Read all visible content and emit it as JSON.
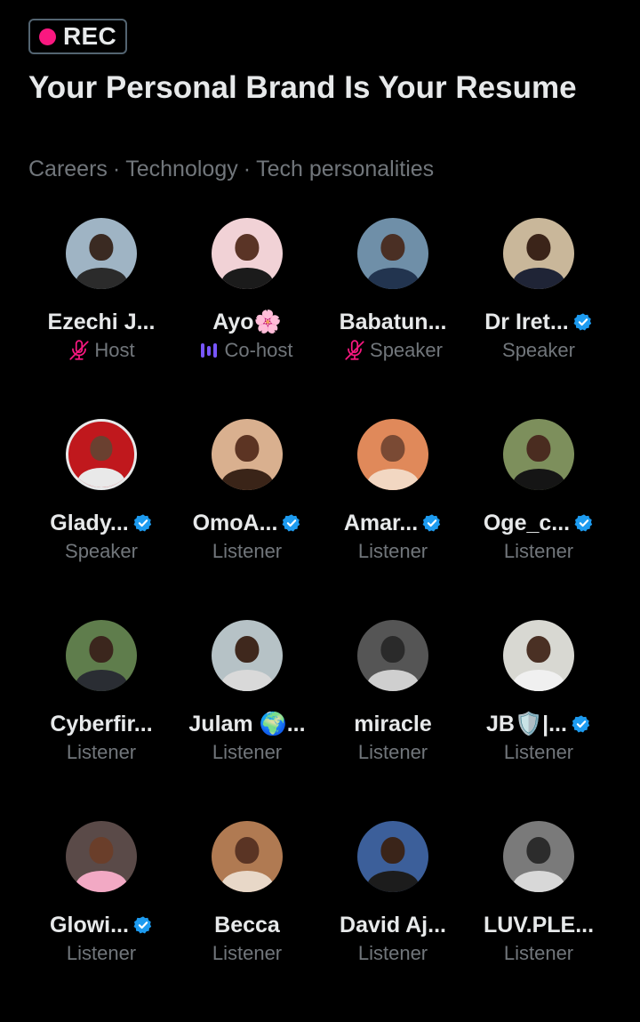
{
  "space": {
    "rec_label": "REC",
    "title": "Your Personal Brand Is Your Resume",
    "topics": [
      "Careers",
      "Technology",
      "Tech personalities"
    ],
    "topic_separator": "·"
  },
  "colors": {
    "rec_dot": "#f91880",
    "verified": "#1d9bf0",
    "muted_mic": "#f91880",
    "speaking": "#7856ff",
    "secondary_text": "#71767b"
  },
  "participants": [
    {
      "name": "Ezechi J...",
      "role": "Host",
      "verified": false,
      "mic": "muted",
      "avatar": {
        "bg": "#9fb4c4",
        "skin": "#3a2a22",
        "shirt": "#2b2b2b",
        "ring": false
      }
    },
    {
      "name": "Ayo🌸",
      "role": "Co-host",
      "verified": false,
      "mic": "speaking",
      "avatar": {
        "bg": "#f1d2d6",
        "skin": "#5a3426",
        "shirt": "#1b1b1b",
        "ring": false
      }
    },
    {
      "name": "Babatun...",
      "role": "Speaker",
      "verified": false,
      "mic": "muted",
      "avatar": {
        "bg": "#6f8fa8",
        "skin": "#4a2f24",
        "shirt": "#22344f",
        "ring": false
      }
    },
    {
      "name": "Dr Iret...",
      "role": "Speaker",
      "verified": true,
      "mic": "none",
      "avatar": {
        "bg": "#c9b79a",
        "skin": "#3b2419",
        "shirt": "#1f2436",
        "ring": false
      }
    },
    {
      "name": "Glady...",
      "role": "Speaker",
      "verified": true,
      "mic": "none",
      "avatar": {
        "bg": "#c0181d",
        "skin": "#6a4030",
        "shirt": "#e9e9e9",
        "ring": true
      }
    },
    {
      "name": "OmoA...",
      "role": "Listener",
      "verified": true,
      "mic": "none",
      "avatar": {
        "bg": "#d9b08f",
        "skin": "#5c3423",
        "shirt": "#3a2418",
        "ring": false
      }
    },
    {
      "name": "Amar...",
      "role": "Listener",
      "verified": true,
      "mic": "none",
      "avatar": {
        "bg": "#e0895a",
        "skin": "#7a4a34",
        "shirt": "#f2d7c2",
        "ring": false
      }
    },
    {
      "name": "Oge_c...",
      "role": "Listener",
      "verified": true,
      "mic": "none",
      "avatar": {
        "bg": "#7d8f5c",
        "skin": "#4a2c20",
        "shirt": "#151515",
        "ring": false
      }
    },
    {
      "name": "Cyberfir...",
      "role": "Listener",
      "verified": false,
      "mic": "none",
      "avatar": {
        "bg": "#5f7d4c",
        "skin": "#3b261d",
        "shirt": "#2a2d33",
        "ring": false
      }
    },
    {
      "name": "Julam 🌍...",
      "role": "Listener",
      "verified": false,
      "mic": "none",
      "avatar": {
        "bg": "#b6c2c6",
        "skin": "#3f281d",
        "shirt": "#d9d9d9",
        "ring": false
      }
    },
    {
      "name": "miracle",
      "role": "Listener",
      "verified": false,
      "mic": "none",
      "avatar": {
        "bg": "#555555",
        "skin": "#2a2a2a",
        "shirt": "#cfcfcf",
        "ring": false
      }
    },
    {
      "name": "JB🛡️|...",
      "role": "Listener",
      "verified": true,
      "mic": "none",
      "avatar": {
        "bg": "#d8d8d2",
        "skin": "#4a3024",
        "shirt": "#f0f0f0",
        "ring": false
      }
    },
    {
      "name": "Glowi...",
      "role": "Listener",
      "verified": true,
      "mic": "none",
      "avatar": {
        "bg": "#5a4a48",
        "skin": "#6a3e2a",
        "shirt": "#f2a9c4",
        "ring": false
      }
    },
    {
      "name": "Becca",
      "role": "Listener",
      "verified": false,
      "mic": "none",
      "avatar": {
        "bg": "#b07a52",
        "skin": "#5a3424",
        "shirt": "#e8d8c8",
        "ring": false
      }
    },
    {
      "name": "David Aj...",
      "role": "Listener",
      "verified": false,
      "mic": "none",
      "avatar": {
        "bg": "#3c5f9a",
        "skin": "#3a2419",
        "shirt": "#1c1c1c",
        "ring": false
      }
    },
    {
      "name": "LUV.PLE...",
      "role": "Listener",
      "verified": false,
      "mic": "none",
      "avatar": {
        "bg": "#7a7a7a",
        "skin": "#2c2c2c",
        "shirt": "#d8d8d8",
        "ring": false
      }
    }
  ]
}
